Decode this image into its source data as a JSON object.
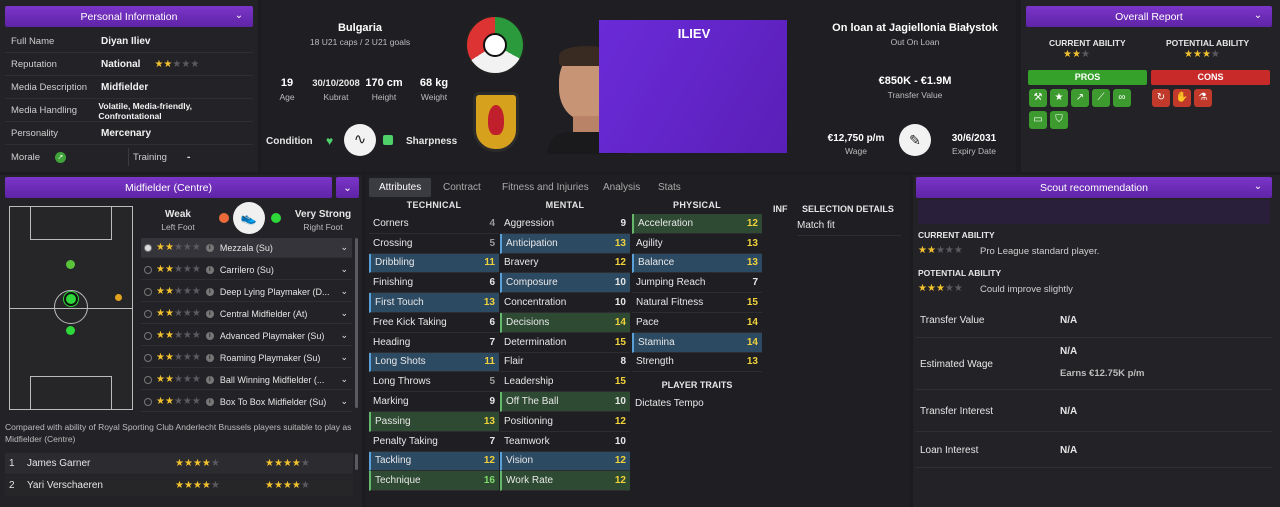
{
  "personal": {
    "title": "Personal Information",
    "rows": [
      {
        "k": "Full Name",
        "v": "Diyan Iliev"
      },
      {
        "k": "Reputation",
        "v": "National"
      },
      {
        "k": "Media Description",
        "v": "Midfielder"
      },
      {
        "k": "Media Handling",
        "v": "Volatile, Media-friendly, Confrontational"
      },
      {
        "k": "Personality",
        "v": "Mercenary"
      }
    ],
    "morale_label": "Morale",
    "training_label": "Training",
    "training_value": "-"
  },
  "player": {
    "nation": "Bulgaria",
    "caps": "18 U21 caps / 2 U21 goals",
    "age": "19",
    "age_label": "Age",
    "dob": "30/10/2008",
    "birthplace": "Kubrat",
    "height": "170 cm",
    "height_label": "Height",
    "weight": "68 kg",
    "weight_label": "Weight",
    "condition_label": "Condition",
    "sharpness_label": "Sharpness",
    "name": "ILIEV"
  },
  "contract": {
    "loan": "On loan at Jagiellonia Białystok",
    "status": "Out On Loan",
    "value": "€850K - €1.9M",
    "value_label": "Transfer Value",
    "wage": "€12,750 p/m",
    "wage_label": "Wage",
    "expiry": "30/6/2031",
    "expiry_label": "Expiry Date"
  },
  "overall": {
    "title": "Overall Report",
    "ca_label": "CURRENT ABILITY",
    "pa_label": "POTENTIAL ABILITY",
    "pros_label": "PROS",
    "cons_label": "CONS"
  },
  "position": {
    "title": "Midfielder (Centre)",
    "weak": "Weak",
    "weak_sub": "Left Foot",
    "strong": "Very Strong",
    "strong_sub": "Right Foot",
    "roles": [
      "Mezzala (Su)",
      "Carrilero (Su)",
      "Deep Lying Playmaker (D...",
      "Central Midfielder (At)",
      "Advanced Playmaker (Su)",
      "Roaming Playmaker (Su)",
      "Ball Winning Midfielder (...",
      "Box To Box Midfielder (Su)"
    ],
    "compare_text": "Compared with ability of Royal Sporting Club Anderlecht Brussels players suitable to play as Midfielder (Centre)",
    "compare": [
      {
        "n": "1",
        "name": "James Garner"
      },
      {
        "n": "2",
        "name": "Yari Verschaeren"
      }
    ]
  },
  "tabs": [
    "Attributes",
    "Contract",
    "Fitness and Injuries",
    "Analysis",
    "Stats"
  ],
  "attributes": {
    "technical_label": "TECHNICAL",
    "mental_label": "MENTAL",
    "physical_label": "PHYSICAL",
    "inf_label": "INF",
    "selection_label": "SELECTION DETAILS",
    "selection_value": "Match fit",
    "traits_label": "PLAYER TRAITS",
    "trait": "Dictates Tempo",
    "technical": [
      [
        "Corners",
        "4",
        ""
      ],
      [
        "Crossing",
        "5",
        ""
      ],
      [
        "Dribbling",
        "11",
        "b"
      ],
      [
        "Finishing",
        "6",
        ""
      ],
      [
        "First Touch",
        "13",
        "b"
      ],
      [
        "Free Kick Taking",
        "6",
        ""
      ],
      [
        "Heading",
        "7",
        ""
      ],
      [
        "Long Shots",
        "11",
        "b"
      ],
      [
        "Long Throws",
        "5",
        ""
      ],
      [
        "Marking",
        "9",
        ""
      ],
      [
        "Passing",
        "13",
        "g"
      ],
      [
        "Penalty Taking",
        "7",
        ""
      ],
      [
        "Tackling",
        "12",
        "b"
      ],
      [
        "Technique",
        "16",
        "g"
      ]
    ],
    "mental": [
      [
        "Aggression",
        "9",
        ""
      ],
      [
        "Anticipation",
        "13",
        "b"
      ],
      [
        "Bravery",
        "12",
        ""
      ],
      [
        "Composure",
        "10",
        "b"
      ],
      [
        "Concentration",
        "10",
        ""
      ],
      [
        "Decisions",
        "14",
        "g"
      ],
      [
        "Determination",
        "15",
        ""
      ],
      [
        "Flair",
        "8",
        ""
      ],
      [
        "Leadership",
        "15",
        ""
      ],
      [
        "Off The Ball",
        "10",
        "g"
      ],
      [
        "Positioning",
        "12",
        ""
      ],
      [
        "Teamwork",
        "10",
        ""
      ],
      [
        "Vision",
        "12",
        "b"
      ],
      [
        "Work Rate",
        "12",
        "g"
      ]
    ],
    "physical": [
      [
        "Acceleration",
        "12",
        "g"
      ],
      [
        "Agility",
        "13",
        ""
      ],
      [
        "Balance",
        "13",
        "b"
      ],
      [
        "Jumping Reach",
        "7",
        ""
      ],
      [
        "Natural Fitness",
        "15",
        ""
      ],
      [
        "Pace",
        "14",
        ""
      ],
      [
        "Stamina",
        "14",
        "b"
      ],
      [
        "Strength",
        "13",
        ""
      ]
    ]
  },
  "scout": {
    "title": "Scout recommendation",
    "ca_label": "CURRENT ABILITY",
    "ca_text": "Pro League standard player.",
    "pa_label": "POTENTIAL ABILITY",
    "pa_text": "Could improve slightly",
    "rows": [
      {
        "k": "Transfer Value",
        "v": "N/A"
      },
      {
        "k": "Estimated Wage",
        "v": "N/A",
        "sub": "Earns €12.75K p/m"
      },
      {
        "k": "Transfer Interest",
        "v": "N/A"
      },
      {
        "k": "Loan Interest",
        "v": "N/A"
      }
    ]
  },
  "colors": {
    "accent": "#6a2bb8",
    "pro": "#3d9a2e",
    "con": "#c0392b",
    "star": "#f2c12e"
  }
}
